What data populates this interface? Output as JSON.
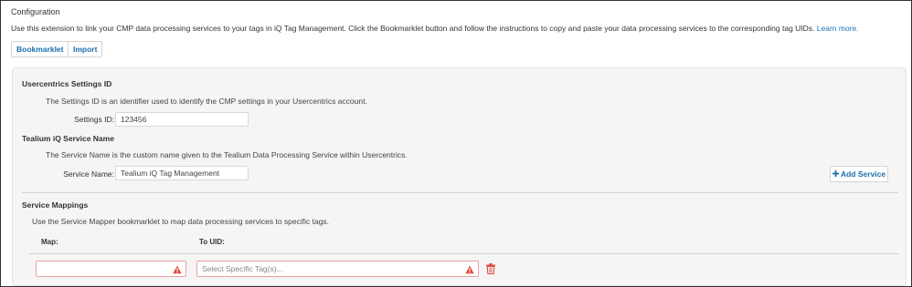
{
  "header": {
    "title": "Configuration",
    "intro_text": "Use this extension to link your CMP data processing services to your tags in iQ Tag Management. Click the Bookmarklet button and follow the instructions to copy and paste your data processing services to the corresponding tag UIDs.",
    "learn_more": "Learn more."
  },
  "toolbar": {
    "bookmarklet_label": "Bookmarklet",
    "import_label": "Import"
  },
  "settings_id": {
    "heading": "Usercentrics Settings ID",
    "description": "The Settings ID is an identifier used to identify the CMP settings in your Usercentrics account.",
    "label": "Settings ID:",
    "value": "123456"
  },
  "service_name": {
    "heading": "Tealium iQ Service Name",
    "description": "The Service Name is the custom name given to the Tealium Data Processing Service within Usercentrics.",
    "label": "Service Name:",
    "value": "Tealium iQ Tag Management"
  },
  "mappings": {
    "heading": "Service Mappings",
    "description": "Use the Service Mapper bookmarklet to map data processing services to specific tags.",
    "col_map": "Map:",
    "col_uid": "To UID:",
    "add_label": "Add Service",
    "add_icon": "plus-icon",
    "row": {
      "map_value": "",
      "uid_placeholder": "Select Specific Tag(s)...",
      "warning_icon": "warning-icon",
      "delete_icon": "trash-icon"
    }
  },
  "colors": {
    "link": "#1a73b5",
    "error_border": "#e8a0a0",
    "warning": "#e0473a"
  }
}
